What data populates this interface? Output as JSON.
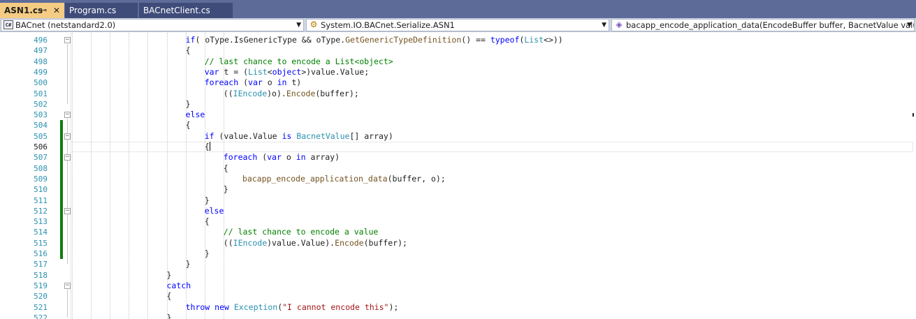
{
  "tabs": [
    {
      "label": "ASN1.cs",
      "active": true
    },
    {
      "label": "Program.cs",
      "active": false
    },
    {
      "label": "BACnetClient.cs",
      "active": false
    }
  ],
  "tab_icons": {
    "pin": "pin-icon",
    "close": "close-icon"
  },
  "nav": {
    "project": "BACnet (netstandard2.0)",
    "type": "System.IO.BACnet.Serialize.ASN1",
    "member": "bacapp_encode_application_data(EncodeBuffer buffer, BacnetValue value)"
  },
  "colors": {
    "keyword": "#0000ff",
    "type": "#2b91af",
    "method": "#74531f",
    "comment": "#008000",
    "string": "#a31515",
    "change_bar": "#107c10",
    "active_tab": "#f5cc84"
  },
  "current_line": "506",
  "lines": [
    {
      "n": "496",
      "i": 6,
      "fold": true,
      "code": [
        [
          "kw",
          "if"
        ],
        [
          "",
          "( "
        ],
        [
          "",
          "oType.IsGenericType && oType."
        ],
        [
          "mt",
          "GetGenericTypeDefinition"
        ],
        [
          "",
          "() == "
        ],
        [
          "kw",
          "typeof"
        ],
        [
          "",
          "("
        ],
        [
          "ty",
          "List"
        ],
        [
          "",
          "<>))"
        ]
      ]
    },
    {
      "n": "497",
      "i": 6,
      "code": [
        [
          "",
          "{"
        ]
      ]
    },
    {
      "n": "498",
      "i": 7,
      "code": [
        [
          "cm",
          "// last chance to encode a List<object>"
        ]
      ]
    },
    {
      "n": "499",
      "i": 7,
      "code": [
        [
          "kw",
          "var"
        ],
        [
          "",
          " t = ("
        ],
        [
          "ty",
          "List"
        ],
        [
          "",
          "<"
        ],
        [
          "kw",
          "object"
        ],
        [
          "",
          ">)value.Value;"
        ]
      ]
    },
    {
      "n": "500",
      "i": 7,
      "code": [
        [
          "kw",
          "foreach"
        ],
        [
          "",
          " ("
        ],
        [
          "kw",
          "var"
        ],
        [
          "",
          " o "
        ],
        [
          "kw",
          "in"
        ],
        [
          "",
          " t)"
        ]
      ]
    },
    {
      "n": "501",
      "i": 8,
      "code": [
        [
          "",
          "(("
        ],
        [
          "ty",
          "IEncode"
        ],
        [
          "",
          ")o)."
        ],
        [
          "mt",
          "Encode"
        ],
        [
          "",
          "(buffer);"
        ]
      ]
    },
    {
      "n": "502",
      "i": 6,
      "code": [
        [
          "",
          "}"
        ]
      ]
    },
    {
      "n": "503",
      "i": 6,
      "fold": true,
      "code": [
        [
          "kw",
          "else"
        ]
      ]
    },
    {
      "n": "504",
      "i": 6,
      "code": [
        [
          "",
          "{"
        ]
      ]
    },
    {
      "n": "505",
      "i": 7,
      "fold": true,
      "code": [
        [
          "kw",
          "if"
        ],
        [
          "",
          " (value.Value "
        ],
        [
          "kw",
          "is"
        ],
        [
          "",
          " "
        ],
        [
          "ty",
          "BacnetValue"
        ],
        [
          "",
          "[] array)"
        ]
      ]
    },
    {
      "n": "506",
      "i": 7,
      "code": [
        [
          "",
          "{"
        ]
      ]
    },
    {
      "n": "507",
      "i": 8,
      "fold": true,
      "code": [
        [
          "kw",
          "foreach"
        ],
        [
          "",
          " ("
        ],
        [
          "kw",
          "var"
        ],
        [
          "",
          " o "
        ],
        [
          "kw",
          "in"
        ],
        [
          "",
          " array)"
        ]
      ]
    },
    {
      "n": "508",
      "i": 8,
      "code": [
        [
          "",
          "{"
        ]
      ]
    },
    {
      "n": "509",
      "i": 9,
      "code": [
        [
          "mt",
          "bacapp_encode_application_data"
        ],
        [
          "",
          "(buffer, o);"
        ]
      ]
    },
    {
      "n": "510",
      "i": 8,
      "code": [
        [
          "",
          "}"
        ]
      ]
    },
    {
      "n": "511",
      "i": 7,
      "code": [
        [
          "",
          "}"
        ]
      ]
    },
    {
      "n": "512",
      "i": 7,
      "fold": true,
      "code": [
        [
          "kw",
          "else"
        ]
      ]
    },
    {
      "n": "513",
      "i": 7,
      "code": [
        [
          "",
          "{"
        ]
      ]
    },
    {
      "n": "514",
      "i": 8,
      "code": [
        [
          "cm",
          "// last chance to encode a value"
        ]
      ]
    },
    {
      "n": "515",
      "i": 8,
      "code": [
        [
          "",
          "(("
        ],
        [
          "ty",
          "IEncode"
        ],
        [
          "",
          ")value.Value)."
        ],
        [
          "mt",
          "Encode"
        ],
        [
          "",
          "(buffer);"
        ]
      ]
    },
    {
      "n": "516",
      "i": 7,
      "code": [
        [
          "",
          "}"
        ]
      ]
    },
    {
      "n": "517",
      "i": 6,
      "code": [
        [
          "",
          "}"
        ]
      ]
    },
    {
      "n": "518",
      "i": 5,
      "code": [
        [
          "",
          "}"
        ]
      ]
    },
    {
      "n": "519",
      "i": 5,
      "fold": true,
      "code": [
        [
          "kw",
          "catch"
        ]
      ]
    },
    {
      "n": "520",
      "i": 5,
      "code": [
        [
          "",
          "{"
        ]
      ]
    },
    {
      "n": "521",
      "i": 6,
      "code": [
        [
          "kw",
          "throw"
        ],
        [
          "",
          " "
        ],
        [
          "kw",
          "new"
        ],
        [
          "",
          " "
        ],
        [
          "ty",
          "Exception"
        ],
        [
          "",
          "("
        ],
        [
          "st",
          "\"I cannot encode this\""
        ],
        [
          "",
          ");"
        ]
      ]
    },
    {
      "n": "522",
      "i": 5,
      "code": [
        [
          "",
          "}"
        ]
      ]
    }
  ]
}
